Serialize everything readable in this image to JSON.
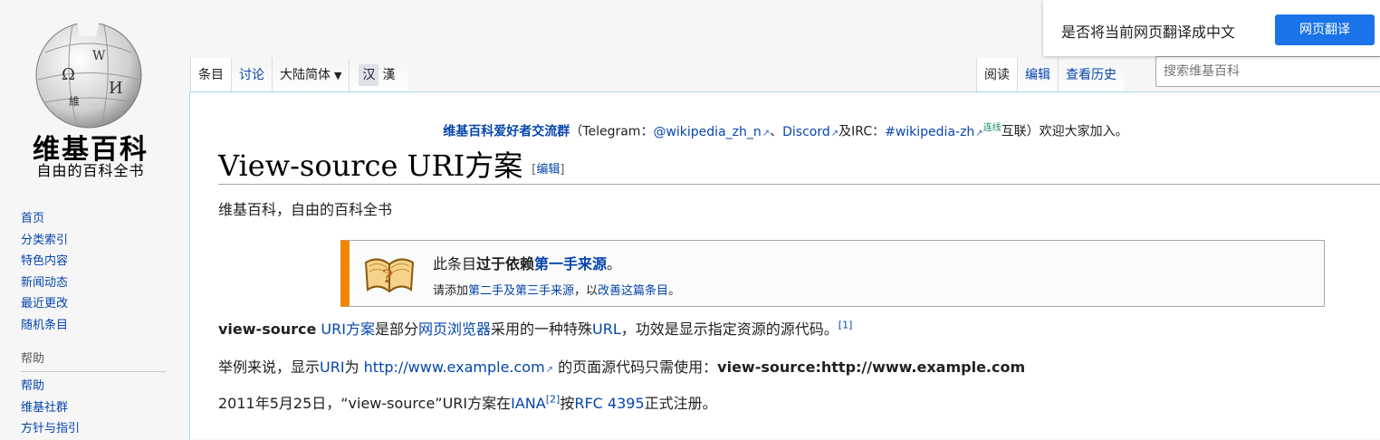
{
  "logo": {
    "wordmark": "维基百科",
    "tagline": "自由的百科全书"
  },
  "sidebar": {
    "nav": [
      "首页",
      "分类索引",
      "特色内容",
      "新闻动态",
      "最近更改",
      "随机条目"
    ],
    "help_heading": "帮助",
    "help": [
      "帮助",
      "维基社群",
      "方针与指引"
    ]
  },
  "tabs": {
    "article": "条目",
    "talk": "讨论",
    "variant": "大陆简体",
    "simplified": "汉",
    "traditional": "漢",
    "read": "阅读",
    "edit": "编辑",
    "history": "查看历史"
  },
  "search": {
    "placeholder": "搜索维基百科"
  },
  "translate": {
    "message": "是否将当前网页翻译成中文",
    "button": "网页翻译"
  },
  "sitenotice": {
    "group": "维基百科爱好者交流群",
    "t1": "（Telegram：",
    "telegram": "@wikipedia_zh_n",
    "sep": "、",
    "discord": "Discord",
    "and_irc": "及IRC：",
    "irc": "#wikipedia-zh",
    "linked": "连线",
    "t2": "互联）欢迎大家加入。"
  },
  "article": {
    "title": "View-source URI方案",
    "edit_open": "[",
    "edit_label": "编辑",
    "edit_close": "]",
    "from": "维基百科，自由的百科全书"
  },
  "ambox": {
    "p1": "此条目",
    "p1_bold": "过于依赖",
    "p1_link": "第一手来源",
    "p1_end": "。",
    "p2": "请添加",
    "p2_link1": "第二手及第三手来源",
    "p2_mid": "，以",
    "p2_link2": "改善这篇条目",
    "p2_end": "。"
  },
  "paras": {
    "p1_bold": "view-source",
    "p1_link1": "URI方案",
    "p1_t1": "是部分",
    "p1_link2": "网页浏览器",
    "p1_t2": "采用的一种特殊",
    "p1_link3": "URL",
    "p1_t3": "，功效是显示指定资源的源代码。",
    "p1_ref": "[1]",
    "p2_t1": "举例来说，显示",
    "p2_link1": "URI",
    "p2_t2": "为 ",
    "p2_link2": "http://www.example.com",
    "p2_t3": " 的页面源代码只需使用：",
    "p2_bold": "view-source:http://www.example.com",
    "p3_t1": "2011年5月25日，“view-source”URI方案在",
    "p3_link1": "IANA",
    "p3_ref": "[2]",
    "p3_t2": "按",
    "p3_link2": "RFC 4395",
    "p3_t3": "正式注册。"
  }
}
